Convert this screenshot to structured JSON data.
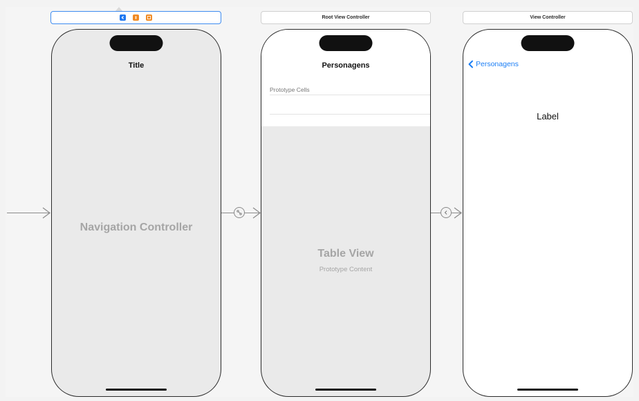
{
  "scenes": [
    {
      "header": "",
      "title": "Title",
      "watermark": "Navigation Controller",
      "dock_icons": [
        "navigation-controller-icon",
        "first-responder-icon",
        "exit-icon"
      ]
    },
    {
      "header": "Root View Controller",
      "title": "Personagens",
      "section_header": "Prototype Cells",
      "watermark": "Table View",
      "watermark_sub": "Prototype Content"
    },
    {
      "header": "View Controller",
      "back_label": "Personagens",
      "label": "Label"
    }
  ],
  "colors": {
    "canvas": "#f3f3f3",
    "selection_blue": "#3d8bf0",
    "ios_blue": "#1a7ef5",
    "dock_orange": "#f08a24",
    "phone_gray": "#eaeaea"
  },
  "segues": [
    "relationship-segue",
    "show-segue"
  ]
}
